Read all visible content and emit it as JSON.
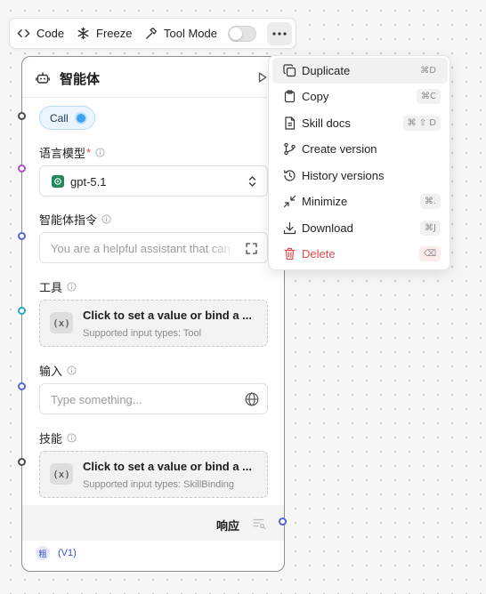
{
  "toolbar": {
    "code_label": "Code",
    "freeze_label": "Freeze",
    "tool_mode_label": "Tool Mode",
    "tool_mode_on": false
  },
  "node": {
    "title": "智能体",
    "call_label": "Call",
    "model_label": "语言模型",
    "required_mark": "*",
    "model_value": "gpt-5.1",
    "instruction_label": "智能体指令",
    "instruction_placeholder": "You are a helpful assistant that can",
    "tools_label": "工具",
    "tools_box_title": "Click to set a value or bind a ...",
    "tools_box_sub": "Supported input types: Tool",
    "input_label": "输入",
    "input_placeholder": "Type something...",
    "skills_label": "技能",
    "skills_box_title": "Click to set a value or bind a ...",
    "skills_box_sub": "Supported input types: SkillBinding",
    "response_label": "响应",
    "version_badge": "粗",
    "version_text": "(V1)",
    "var_icon_glyph": "(x)"
  },
  "menu": {
    "items": [
      {
        "label": "Duplicate",
        "shortcut": "⌘D",
        "icon": "duplicate-icon"
      },
      {
        "label": "Copy",
        "shortcut": "⌘C",
        "icon": "copy-icon"
      },
      {
        "label": "Skill docs",
        "shortcut": "⌘ ⇧ D",
        "icon": "document-icon"
      },
      {
        "label": "Create version",
        "shortcut": "",
        "icon": "branch-icon"
      },
      {
        "label": "History versions",
        "shortcut": "",
        "icon": "history-icon"
      },
      {
        "label": "Minimize",
        "shortcut": "⌘.",
        "icon": "minimize-icon"
      },
      {
        "label": "Download",
        "shortcut": "⌘J",
        "icon": "download-icon"
      },
      {
        "label": "Delete",
        "shortcut": "⌫",
        "icon": "trash-icon"
      }
    ]
  },
  "colors": {
    "accent_blue": "#3ca3ec",
    "danger_red": "#e5484d",
    "model_green": "#1f8a5b",
    "handle_purple": "#b04fc9",
    "handle_indigo": "#5862d8",
    "handle_cyan": "#2aa7c6"
  }
}
